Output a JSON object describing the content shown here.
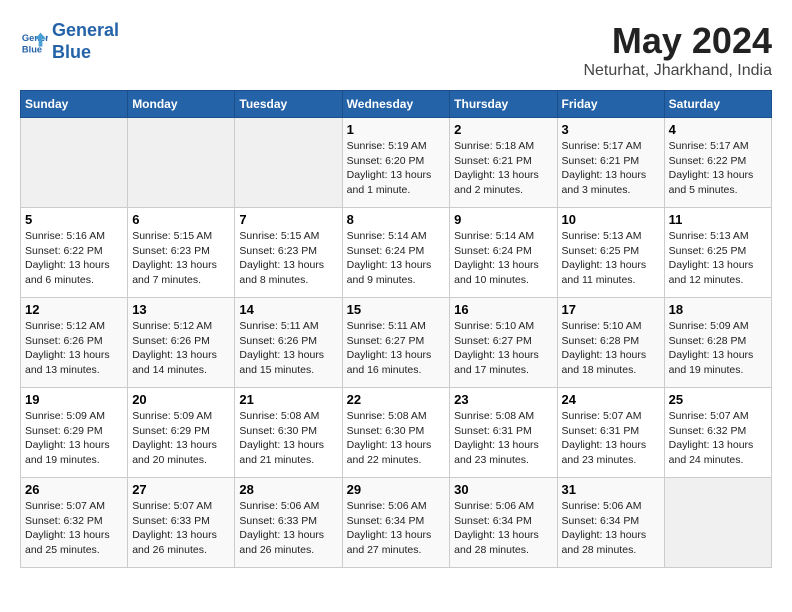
{
  "header": {
    "logo_line1": "General",
    "logo_line2": "Blue",
    "month": "May 2024",
    "location": "Neturhat, Jharkhand, India"
  },
  "days_of_week": [
    "Sunday",
    "Monday",
    "Tuesday",
    "Wednesday",
    "Thursday",
    "Friday",
    "Saturday"
  ],
  "weeks": [
    [
      {
        "day": "",
        "content": ""
      },
      {
        "day": "",
        "content": ""
      },
      {
        "day": "",
        "content": ""
      },
      {
        "day": "1",
        "content": "Sunrise: 5:19 AM\nSunset: 6:20 PM\nDaylight: 13 hours\nand 1 minute."
      },
      {
        "day": "2",
        "content": "Sunrise: 5:18 AM\nSunset: 6:21 PM\nDaylight: 13 hours\nand 2 minutes."
      },
      {
        "day": "3",
        "content": "Sunrise: 5:17 AM\nSunset: 6:21 PM\nDaylight: 13 hours\nand 3 minutes."
      },
      {
        "day": "4",
        "content": "Sunrise: 5:17 AM\nSunset: 6:22 PM\nDaylight: 13 hours\nand 5 minutes."
      }
    ],
    [
      {
        "day": "5",
        "content": "Sunrise: 5:16 AM\nSunset: 6:22 PM\nDaylight: 13 hours\nand 6 minutes."
      },
      {
        "day": "6",
        "content": "Sunrise: 5:15 AM\nSunset: 6:23 PM\nDaylight: 13 hours\nand 7 minutes."
      },
      {
        "day": "7",
        "content": "Sunrise: 5:15 AM\nSunset: 6:23 PM\nDaylight: 13 hours\nand 8 minutes."
      },
      {
        "day": "8",
        "content": "Sunrise: 5:14 AM\nSunset: 6:24 PM\nDaylight: 13 hours\nand 9 minutes."
      },
      {
        "day": "9",
        "content": "Sunrise: 5:14 AM\nSunset: 6:24 PM\nDaylight: 13 hours\nand 10 minutes."
      },
      {
        "day": "10",
        "content": "Sunrise: 5:13 AM\nSunset: 6:25 PM\nDaylight: 13 hours\nand 11 minutes."
      },
      {
        "day": "11",
        "content": "Sunrise: 5:13 AM\nSunset: 6:25 PM\nDaylight: 13 hours\nand 12 minutes."
      }
    ],
    [
      {
        "day": "12",
        "content": "Sunrise: 5:12 AM\nSunset: 6:26 PM\nDaylight: 13 hours\nand 13 minutes."
      },
      {
        "day": "13",
        "content": "Sunrise: 5:12 AM\nSunset: 6:26 PM\nDaylight: 13 hours\nand 14 minutes."
      },
      {
        "day": "14",
        "content": "Sunrise: 5:11 AM\nSunset: 6:26 PM\nDaylight: 13 hours\nand 15 minutes."
      },
      {
        "day": "15",
        "content": "Sunrise: 5:11 AM\nSunset: 6:27 PM\nDaylight: 13 hours\nand 16 minutes."
      },
      {
        "day": "16",
        "content": "Sunrise: 5:10 AM\nSunset: 6:27 PM\nDaylight: 13 hours\nand 17 minutes."
      },
      {
        "day": "17",
        "content": "Sunrise: 5:10 AM\nSunset: 6:28 PM\nDaylight: 13 hours\nand 18 minutes."
      },
      {
        "day": "18",
        "content": "Sunrise: 5:09 AM\nSunset: 6:28 PM\nDaylight: 13 hours\nand 19 minutes."
      }
    ],
    [
      {
        "day": "19",
        "content": "Sunrise: 5:09 AM\nSunset: 6:29 PM\nDaylight: 13 hours\nand 19 minutes."
      },
      {
        "day": "20",
        "content": "Sunrise: 5:09 AM\nSunset: 6:29 PM\nDaylight: 13 hours\nand 20 minutes."
      },
      {
        "day": "21",
        "content": "Sunrise: 5:08 AM\nSunset: 6:30 PM\nDaylight: 13 hours\nand 21 minutes."
      },
      {
        "day": "22",
        "content": "Sunrise: 5:08 AM\nSunset: 6:30 PM\nDaylight: 13 hours\nand 22 minutes."
      },
      {
        "day": "23",
        "content": "Sunrise: 5:08 AM\nSunset: 6:31 PM\nDaylight: 13 hours\nand 23 minutes."
      },
      {
        "day": "24",
        "content": "Sunrise: 5:07 AM\nSunset: 6:31 PM\nDaylight: 13 hours\nand 23 minutes."
      },
      {
        "day": "25",
        "content": "Sunrise: 5:07 AM\nSunset: 6:32 PM\nDaylight: 13 hours\nand 24 minutes."
      }
    ],
    [
      {
        "day": "26",
        "content": "Sunrise: 5:07 AM\nSunset: 6:32 PM\nDaylight: 13 hours\nand 25 minutes."
      },
      {
        "day": "27",
        "content": "Sunrise: 5:07 AM\nSunset: 6:33 PM\nDaylight: 13 hours\nand 26 minutes."
      },
      {
        "day": "28",
        "content": "Sunrise: 5:06 AM\nSunset: 6:33 PM\nDaylight: 13 hours\nand 26 minutes."
      },
      {
        "day": "29",
        "content": "Sunrise: 5:06 AM\nSunset: 6:34 PM\nDaylight: 13 hours\nand 27 minutes."
      },
      {
        "day": "30",
        "content": "Sunrise: 5:06 AM\nSunset: 6:34 PM\nDaylight: 13 hours\nand 28 minutes."
      },
      {
        "day": "31",
        "content": "Sunrise: 5:06 AM\nSunset: 6:34 PM\nDaylight: 13 hours\nand 28 minutes."
      },
      {
        "day": "",
        "content": ""
      }
    ]
  ]
}
